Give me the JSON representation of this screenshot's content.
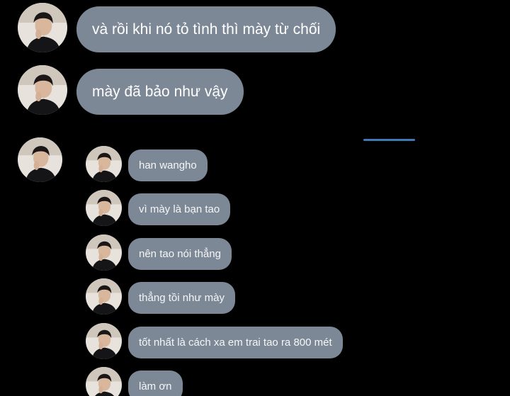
{
  "colors": {
    "background": "#000000",
    "bubble": "#7d8896",
    "bubble_text": "#ffffff",
    "accent_line": "#3f79b8"
  },
  "outer_messages": [
    {
      "avatar": "profile-photo-avatar",
      "text": "và rồi khi nó tỏ tình thì mày từ chối"
    },
    {
      "avatar": "profile-photo-avatar",
      "text": "mày đã bảo như vậy"
    }
  ],
  "third_avatar": "profile-photo-avatar",
  "quoted_messages": [
    {
      "avatar": "profile-photo-avatar",
      "text": "han wangho"
    },
    {
      "avatar": "profile-photo-avatar",
      "text": "vì mày là bạn tao"
    },
    {
      "avatar": "profile-photo-avatar",
      "text": "nên tao nói thẳng"
    },
    {
      "avatar": "profile-photo-avatar",
      "text": "thẳng tồi như mày"
    },
    {
      "avatar": "profile-photo-avatar",
      "text": "tốt nhất là cách xa em trai tao ra 800 mét"
    },
    {
      "avatar": "profile-photo-avatar",
      "text": "làm ơn"
    }
  ]
}
